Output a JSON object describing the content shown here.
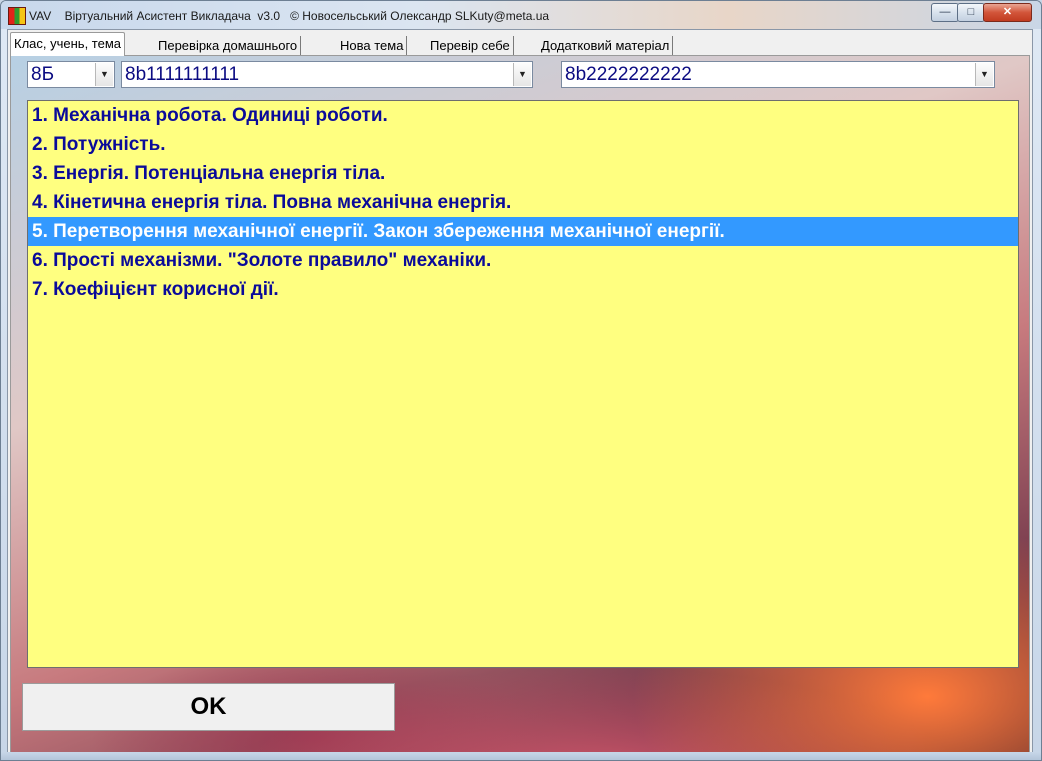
{
  "window": {
    "title": "VAV    Віртуальний Асистент Викладача  v3.0   © Новосельський Олександр SLKuty@meta.ua",
    "app_icon": "vav-app-icon",
    "controls": {
      "minimize": "minimize-icon",
      "maximize": "maximize-icon",
      "close": "close-icon"
    }
  },
  "tabs": [
    {
      "label": "Клас, учень, тема",
      "active": true
    },
    {
      "label": "Перевірка домашнього",
      "active": false
    },
    {
      "label": "Нова тема",
      "active": false
    },
    {
      "label": "Перевір себе",
      "active": false
    },
    {
      "label": "Додатковий матеріал",
      "active": false
    }
  ],
  "selectors": {
    "class": "8Б",
    "student": "8b1111111111",
    "second_student": "8b2222222222"
  },
  "topics": [
    {
      "label": "1. Механічна робота. Одиниці роботи.",
      "selected": false
    },
    {
      "label": "2. Потужність.",
      "selected": false
    },
    {
      "label": "3. Енергія. Потенціальна енергія тіла.",
      "selected": false
    },
    {
      "label": "4. Кінетична енергія тіла. Повна механічна енергія.",
      "selected": false
    },
    {
      "label": "5. Перетворення механічної енергії. Закон збереження механічної енергії.",
      "selected": true
    },
    {
      "label": "6. Прості механізми. \"Золоте правило\" механіки.",
      "selected": false
    },
    {
      "label": "7. Коефіцієнт корисної дії.",
      "selected": false
    }
  ],
  "ok_button": {
    "label": "OK"
  },
  "colors": {
    "list_background": "#ffff80",
    "list_text": "#0b0b9a",
    "selection": "#3399ff"
  }
}
